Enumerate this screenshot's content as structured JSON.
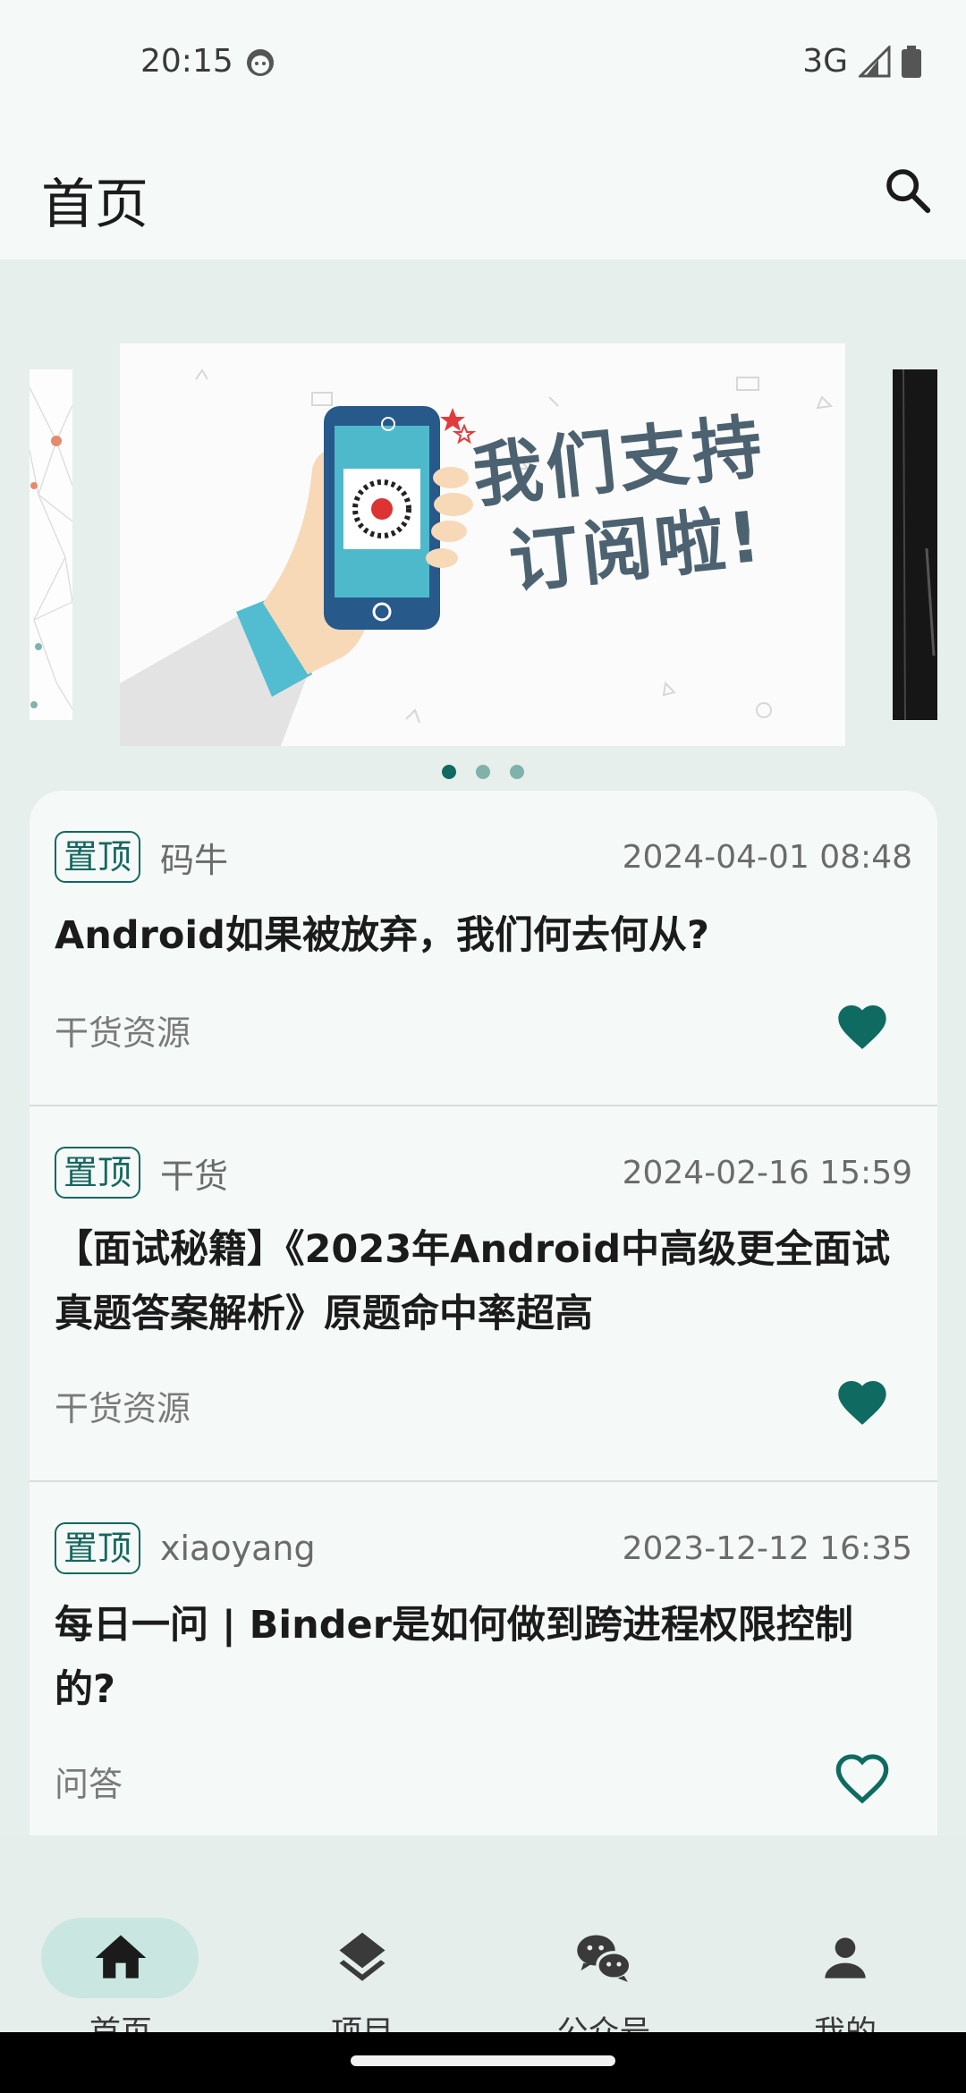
{
  "status": {
    "time": "20:15",
    "network": "3G"
  },
  "app_bar": {
    "title": "首页"
  },
  "banner": {
    "text_line1": "我们支持",
    "text_line2": "订阅啦!",
    "page_count": 3,
    "active_index": 0
  },
  "articles": [
    {
      "tag": "置顶",
      "author": "码牛",
      "date": "2024-04-01 08:48",
      "title": "Android如果被放弃，我们何去何从?",
      "category": "干货资源",
      "favorited": true
    },
    {
      "tag": "置顶",
      "author": "干货",
      "date": "2024-02-16 15:59",
      "title": "【面试秘籍】《2023年Android中高级更全面试真题答案解析》原题命中率超高",
      "category": "干货资源",
      "favorited": true
    },
    {
      "tag": "置顶",
      "author": "xiaoyang",
      "date": "2023-12-12 16:35",
      "title": "每日一问 | Binder是如何做到跨进程权限控制的?",
      "category": "问答",
      "favorited": false
    }
  ],
  "nav": {
    "items": [
      {
        "label": "首页",
        "icon": "home-icon",
        "active": true
      },
      {
        "label": "项目",
        "icon": "layers-icon",
        "active": false
      },
      {
        "label": "公众号",
        "icon": "wechat-icon",
        "active": false
      },
      {
        "label": "我的",
        "icon": "person-icon",
        "active": false
      }
    ]
  },
  "colors": {
    "accent": "#0f6b61",
    "tag_border": "#15675f",
    "active_pill": "#c9e7e0"
  }
}
